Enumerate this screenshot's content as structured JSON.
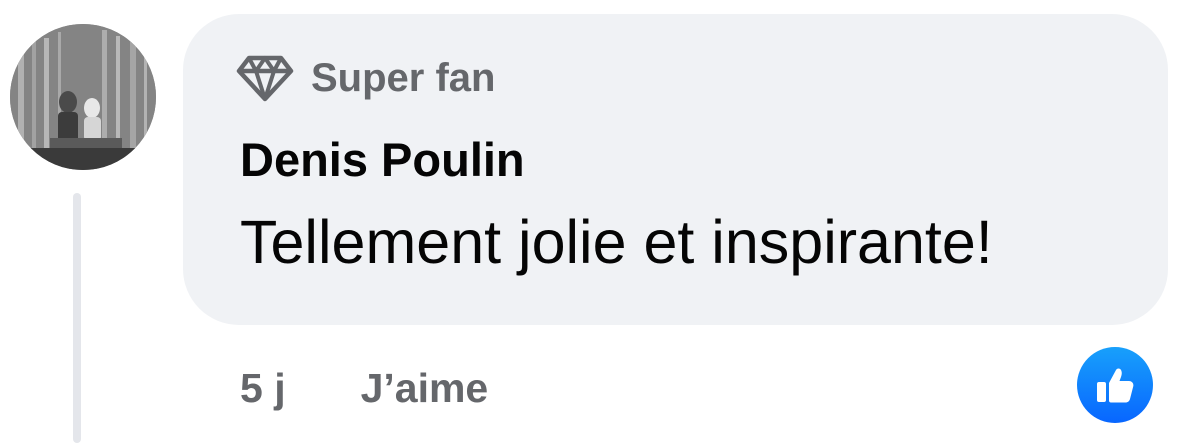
{
  "comment": {
    "badge": {
      "icon": "diamond-icon",
      "label": "Super fan"
    },
    "author": "Denis Poulin",
    "text": "Tellement jolie et inspirante!",
    "timestamp": "5 j",
    "like_label": "J’aime",
    "reaction_icon": "thumbs-up-icon"
  },
  "colors": {
    "bubble": "#f0f2f5",
    "secondary_text": "#65676b",
    "primary_text": "#050505",
    "reaction_blue": "#0866ff",
    "thread_line": "#e4e6eb"
  }
}
